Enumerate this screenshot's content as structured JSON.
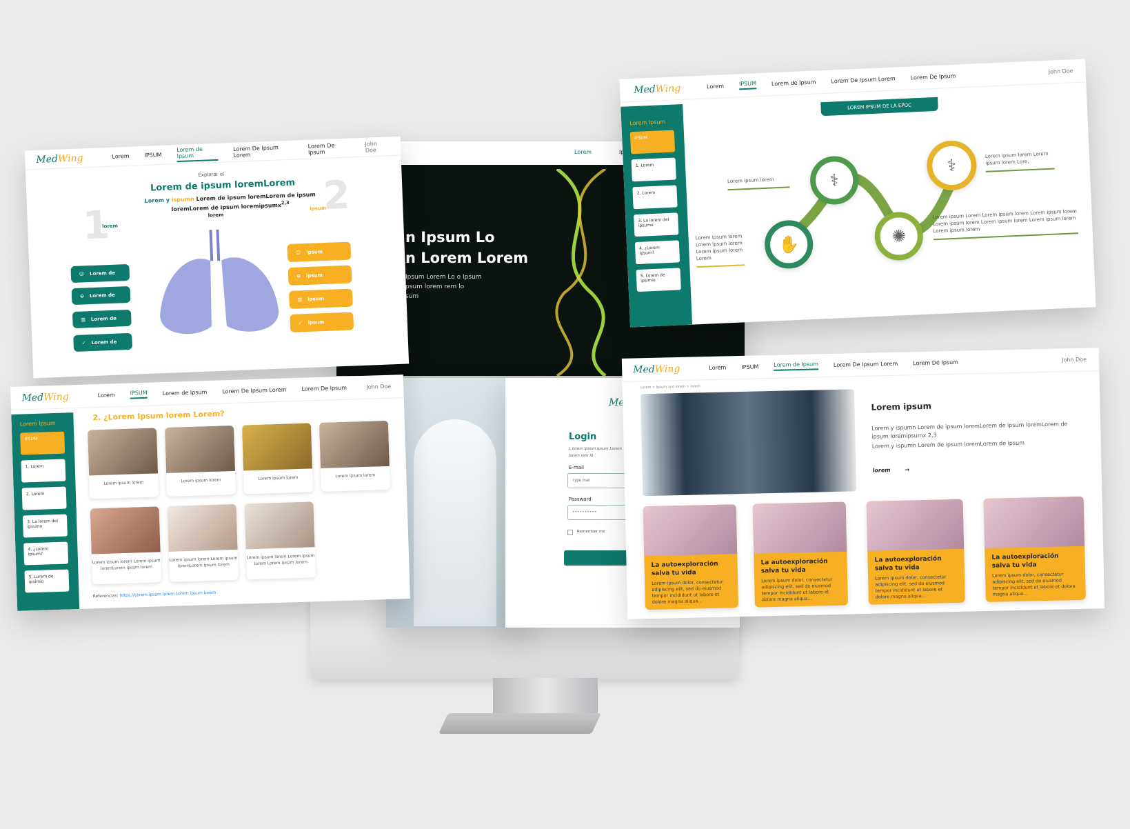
{
  "brand": {
    "logo_a": "Med",
    "logo_b": "Wing",
    "accent": "#0e7a6b",
    "highlight": "#f7b023"
  },
  "user": "John Doe",
  "nav": {
    "n1": "Lorem",
    "n2": "IPSUM",
    "n3": "Lorem de Ipsum",
    "n4": "Lorem De Ipsum Lorem",
    "n5": "Lorem De Ipsum"
  },
  "lungs_page": {
    "explore": "Explorar el",
    "title": "Lorem de ipsum loremLorem",
    "sub_a": "Lorem y",
    "sub_b": "ispumn",
    "sub_c": "Lorem de ipsum loremLorem de ipsum loremLorem de ipsum loremipsumx",
    "sub_sup": "2,3",
    "num1": "1",
    "num2": "2",
    "left_head": "lorem",
    "mid_head": "lorem",
    "right_head": "ipsum",
    "left_btns": [
      "Lorem de",
      "Lorem de",
      "Lorem de",
      "Lorem de"
    ],
    "right_btns": [
      "ipsum",
      "ipsum",
      "ipsum",
      "ipsum"
    ]
  },
  "hero": {
    "nav_item": "Lorem",
    "nav_item2": "Ipsu",
    "line1": "n Ipsum Lo",
    "line2": "n Lorem Lorem",
    "body1": "Ipsum Lorem Lo o Ipsum",
    "body2": "psum lorem rem lo",
    "body3": "sum"
  },
  "epoc": {
    "banner": "LOREM IPSUM DE LA EPOC",
    "side_title": "Lorem Ipsum",
    "side_items": [
      "IPSUM",
      "1. Lorem",
      "2. Lorem",
      "3. La lorem del ipsumo",
      "4. ¿Lorem ipsum?",
      "5. Lorem de ipsimio"
    ],
    "label_a": "Lorem ipsum lorem",
    "label_b": "Lorem ipsum lorem Lorem ipsum lorem Lorem ipsum lorem Lorem",
    "label_c": "Lorem ipsum lorem Lorem ipsum lorem Lore,",
    "label_d": "Lorem ipsum Lorem Lorem ipsum lorem Lorem ipsum lorem Lorem ipsum lorem Lorem ipsum lorem Lorem ipsum lorem Lorem ipsum lorem"
  },
  "symptoms": {
    "side_title": "Lorem Ipsum",
    "side_items": [
      "IPSUM",
      "1. Lorem",
      "2. Lorem",
      "3. La lorem del ipsumo",
      "4. ¿Lorem ipsum?",
      "5. Lorem de ipsimio"
    ],
    "question": "2. ¿Lorem Ipsum lorem Lorem?",
    "captions": [
      "Lorem ipsum lorem",
      "Lorem ipsum lorem",
      "Lorem ipsum lorem",
      "Lorem ipsum lorem",
      "Lorem ipsum lorem Lorem ipsum loremLorem ipsum lorem",
      "Lorem ipsum lorem Lorem ipsum loremLorem ipsum lorem",
      "Lorem ipsum lorem Lorem ipsum lorem Lorem ipsum lorem"
    ],
    "refs_label": "Referencias:",
    "refs_link": "https://Lorem ipsum lorem Lorem ipsum lorem"
  },
  "login": {
    "title": "Login",
    "hint": "L lorem ipsum ipsum Lorem lorem rem lo",
    "email_label": "E-mail",
    "email_placeholder": "Type mail",
    "password_label": "Password",
    "password_value": "••••••••••",
    "remember": "Remember me"
  },
  "xray": {
    "crumb": "Lorem > Ipsum and lorem > lorem",
    "heading": "Lorem ipsum",
    "para1": "Lorem y ispumn Lorem de ipsum loremLorem de ipsum loremLorem de ipsum loremipsumx 2,3",
    "para2": "Lorem y ispumn Lorem de ipsum loremLorem de ipsum",
    "link": "lorem",
    "card_title": "La autoexploración salva tu vida",
    "card_text": "Lorem ipsum dolor, consectetur adipiscing elit, sed do eiusmod tempor incididunt ut labore et dolore magna aliqua..."
  }
}
